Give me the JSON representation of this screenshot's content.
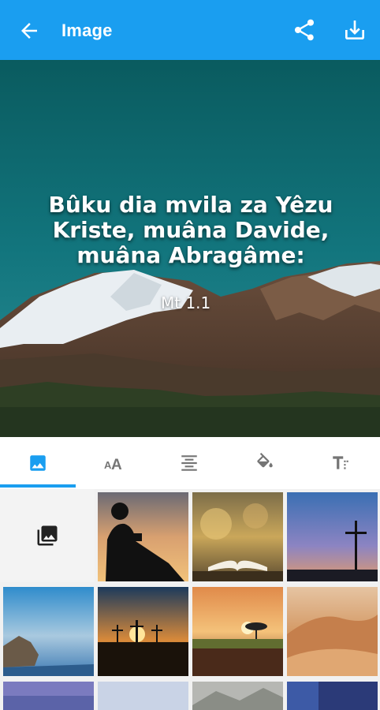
{
  "appbar": {
    "title": "Image",
    "icons": [
      "arrow-back-icon",
      "share-icon",
      "download-icon"
    ]
  },
  "preview": {
    "verse_lines": [
      "Bûku dia mvila za Yêzu",
      "Kriste, muâna Davide,",
      "muâna Abragâme:"
    ],
    "reference": "Mt 1.1"
  },
  "toolbar": {
    "tabs": [
      "background-image",
      "font-size",
      "text-align",
      "text-color",
      "text-style"
    ],
    "active": "background-image"
  },
  "gallery": {
    "picker_icon": "photo-library-icon",
    "thumbnails": [
      "boy-reading-silhouette",
      "open-bible-on-table",
      "cross-at-dusk",
      "rocks-by-calm-sea",
      "three-crosses-sunset",
      "tree-at-sunset",
      "desert-dunes",
      "purple-sky",
      "pale-sky",
      "mountain-clouds",
      "night-sky"
    ]
  },
  "colors": {
    "accent": "#1a9ef0"
  }
}
